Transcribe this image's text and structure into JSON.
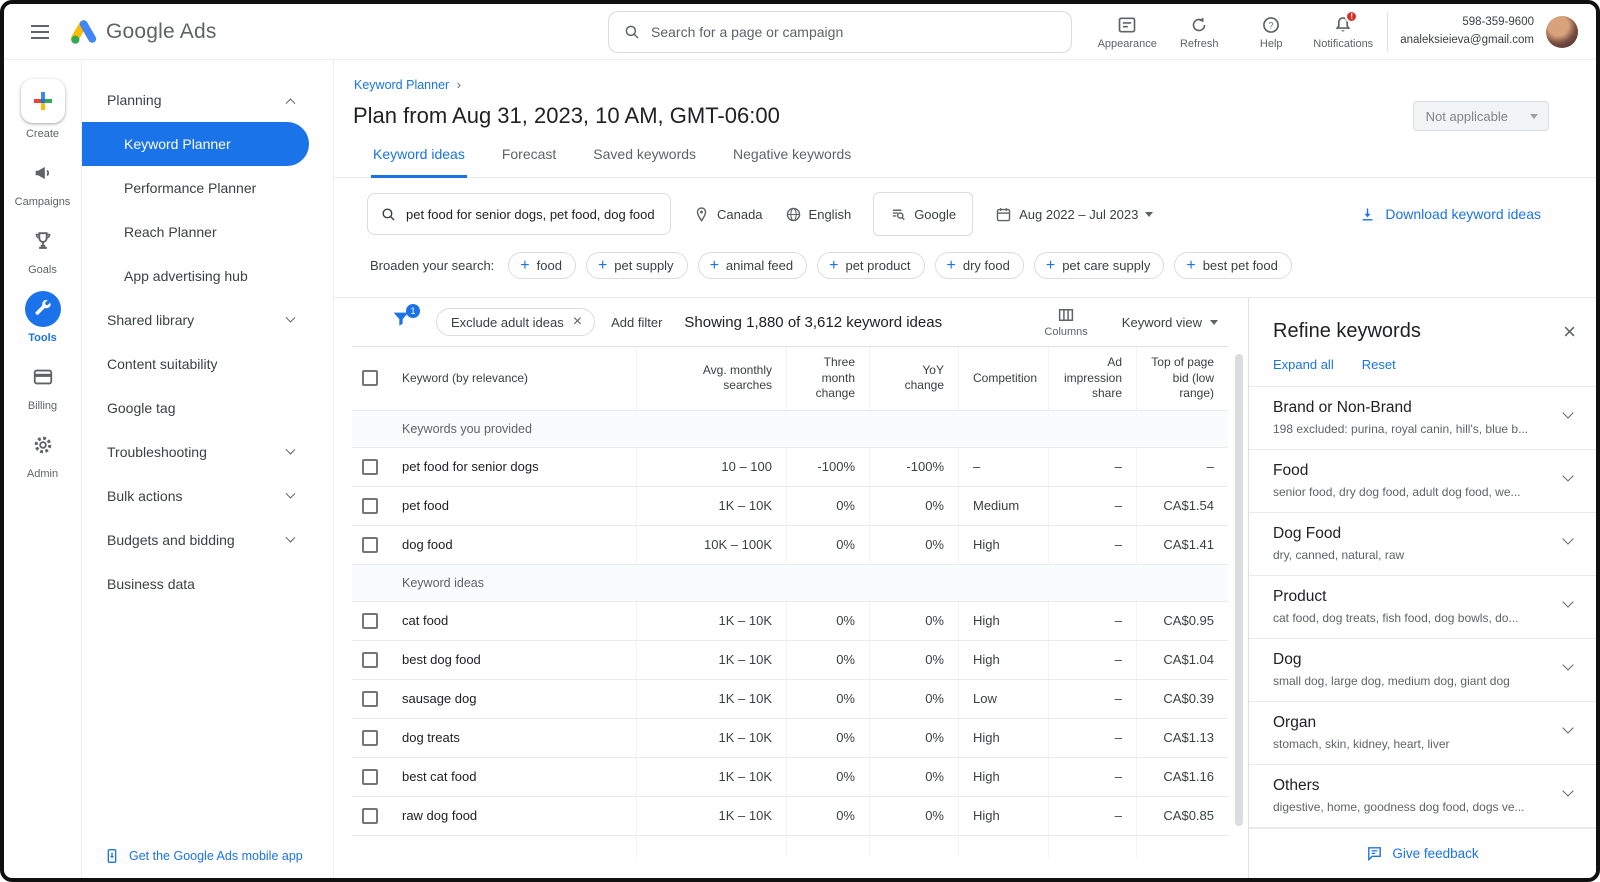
{
  "theme": {
    "accent": "#1a73e8",
    "selected_nav_bg": "#1a73e8",
    "badge_red": "#d93025",
    "text": "#202124",
    "muted": "#5f6368",
    "border": "#dadce0"
  },
  "topbar": {
    "brand": "Google Ads",
    "search_placeholder": "Search for a page or campaign",
    "actions": [
      {
        "label": "Appearance"
      },
      {
        "label": "Refresh"
      },
      {
        "label": "Help"
      },
      {
        "label": "Notifications",
        "badge": "!"
      }
    ],
    "account": {
      "phone": "598-359-9600",
      "email": "analeksieieva@gmail.com"
    }
  },
  "rail": [
    {
      "label": "Create"
    },
    {
      "label": "Campaigns"
    },
    {
      "label": "Goals"
    },
    {
      "label": "Tools",
      "selected": true
    },
    {
      "label": "Billing"
    },
    {
      "label": "Admin"
    }
  ],
  "sidenav": {
    "items": [
      {
        "label": "Planning",
        "type": "header",
        "expand": "up"
      },
      {
        "label": "Keyword Planner",
        "type": "sub",
        "selected": true
      },
      {
        "label": "Performance Planner",
        "type": "sub"
      },
      {
        "label": "Reach Planner",
        "type": "sub"
      },
      {
        "label": "App advertising hub",
        "type": "sub"
      },
      {
        "label": "Shared library",
        "type": "header",
        "expand": "down"
      },
      {
        "label": "Content suitability",
        "type": "item"
      },
      {
        "label": "Google tag",
        "type": "item"
      },
      {
        "label": "Troubleshooting",
        "type": "header",
        "expand": "down"
      },
      {
        "label": "Bulk actions",
        "type": "header",
        "expand": "down"
      },
      {
        "label": "Budgets and bidding",
        "type": "header",
        "expand": "down"
      },
      {
        "label": "Business data",
        "type": "item"
      }
    ],
    "mobile_app": "Get the Google Ads mobile app"
  },
  "header": {
    "breadcrumb": "Keyword Planner",
    "breadcrumb_sep": "›",
    "title": "Plan from Aug 31, 2023, 10 AM, GMT-06:00",
    "status_dropdown": "Not applicable",
    "tabs": [
      {
        "label": "Keyword ideas",
        "selected": true
      },
      {
        "label": "Forecast"
      },
      {
        "label": "Saved keywords"
      },
      {
        "label": "Negative keywords"
      }
    ]
  },
  "toolbar": {
    "keywords": "pet food for senior dogs, pet food, dog food",
    "location": "Canada",
    "language": "English",
    "network": "Google",
    "date_range": "Aug 2022 – Jul 2023",
    "download_label": "Download keyword ideas"
  },
  "broaden": {
    "label": "Broaden your search:",
    "chips": [
      "food",
      "pet supply",
      "animal feed",
      "pet product",
      "dry food",
      "pet care supply",
      "best pet food"
    ]
  },
  "filterbar": {
    "filter_count": "1",
    "active_filter": "Exclude adult ideas",
    "remove_glyph": "×",
    "add_filter": "Add filter",
    "summary": "Showing 1,880 of 3,612 keyword ideas",
    "columns_label": "Columns",
    "view_label": "Keyword view"
  },
  "table": {
    "columns": [
      "Keyword (by relevance)",
      "Avg. monthly searches",
      "Three month change",
      "YoY change",
      "Competition",
      "Ad impression share",
      "Top of page bid (low range)"
    ],
    "provided": {
      "label": "Keywords you provided",
      "rows": [
        {
          "keyword": "pet food for senior dogs",
          "searches": "10 – 100",
          "three_month": "-100%",
          "yoy": "-100%",
          "competition": "–",
          "ad_share": "–",
          "top_bid": "–"
        },
        {
          "keyword": "pet food",
          "searches": "1K – 10K",
          "three_month": "0%",
          "yoy": "0%",
          "competition": "Medium",
          "ad_share": "–",
          "top_bid": "CA$1.54"
        },
        {
          "keyword": "dog food",
          "searches": "10K – 100K",
          "three_month": "0%",
          "yoy": "0%",
          "competition": "High",
          "ad_share": "–",
          "top_bid": "CA$1.41"
        }
      ]
    },
    "ideas": {
      "label": "Keyword ideas",
      "rows": [
        {
          "keyword": "cat food",
          "searches": "1K – 10K",
          "three_month": "0%",
          "yoy": "0%",
          "competition": "High",
          "ad_share": "–",
          "top_bid": "CA$0.95"
        },
        {
          "keyword": "best dog food",
          "searches": "1K – 10K",
          "three_month": "0%",
          "yoy": "0%",
          "competition": "High",
          "ad_share": "–",
          "top_bid": "CA$1.04"
        },
        {
          "keyword": "sausage dog",
          "searches": "1K – 10K",
          "three_month": "0%",
          "yoy": "0%",
          "competition": "Low",
          "ad_share": "–",
          "top_bid": "CA$0.39"
        },
        {
          "keyword": "dog treats",
          "searches": "1K – 10K",
          "three_month": "0%",
          "yoy": "0%",
          "competition": "High",
          "ad_share": "–",
          "top_bid": "CA$1.13"
        },
        {
          "keyword": "best cat food",
          "searches": "1K – 10K",
          "three_month": "0%",
          "yoy": "0%",
          "competition": "High",
          "ad_share": "–",
          "top_bid": "CA$1.16"
        },
        {
          "keyword": "raw dog food",
          "searches": "1K – 10K",
          "three_month": "0%",
          "yoy": "0%",
          "competition": "High",
          "ad_share": "–",
          "top_bid": "CA$0.85"
        }
      ]
    }
  },
  "refine": {
    "title": "Refine keywords",
    "expand_all": "Expand all",
    "reset": "Reset",
    "close_glyph": "×",
    "sections": [
      {
        "title": "Brand or Non-Brand",
        "subtitle": "198 excluded: purina, royal canin, hill's, blue b..."
      },
      {
        "title": "Food",
        "subtitle": "senior food, dry dog food, adult dog food, we..."
      },
      {
        "title": "Dog Food",
        "subtitle": "dry, canned, natural, raw"
      },
      {
        "title": "Product",
        "subtitle": "cat food, dog treats, fish food, dog bowls, do..."
      },
      {
        "title": "Dog",
        "subtitle": "small dog, large dog, medium dog, giant dog"
      },
      {
        "title": "Organ",
        "subtitle": "stomach, skin, kidney, heart, liver"
      },
      {
        "title": "Others",
        "subtitle": "digestive, home, goodness dog food, dogs ve..."
      }
    ],
    "feedback": "Give feedback"
  }
}
